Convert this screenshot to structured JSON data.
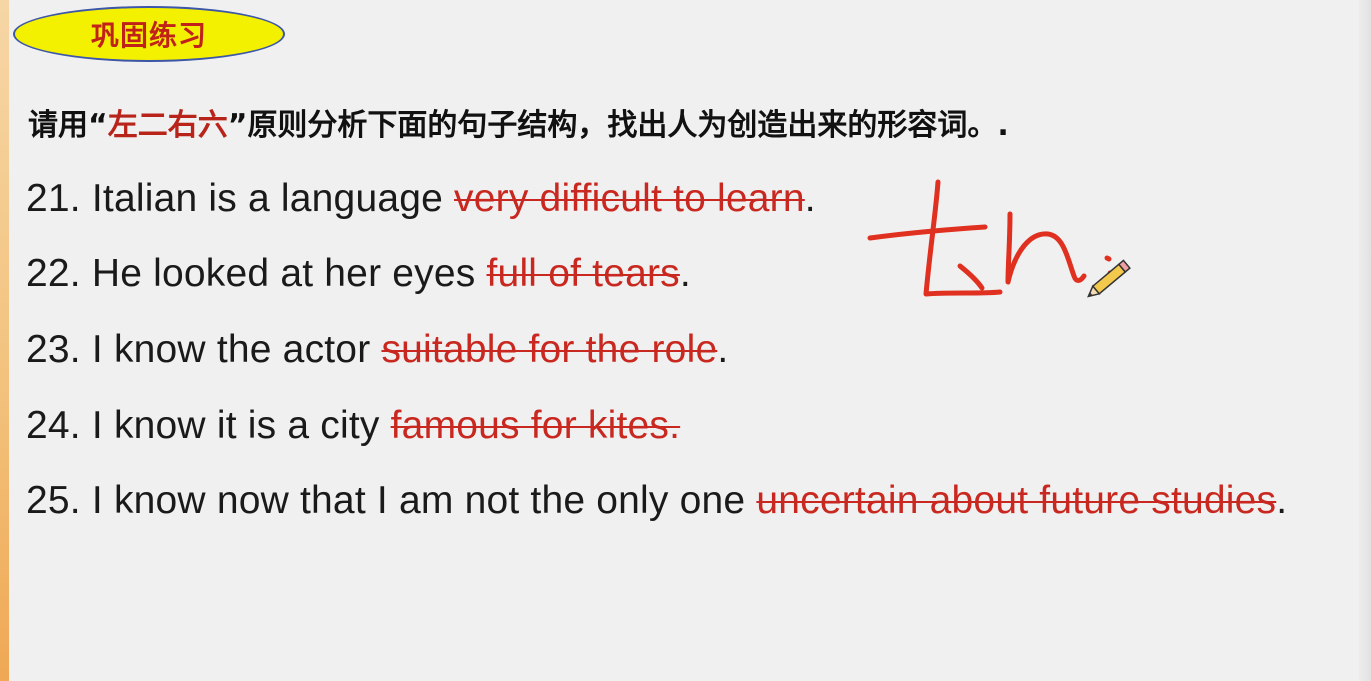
{
  "title": "巩固练习",
  "instruction": {
    "prefix": "请用",
    "open_quote": "“",
    "highlight": "左二右六",
    "close_quote": "”",
    "suffix": "原则分析下面的句子结构，找出人为创造出来的形容词。."
  },
  "sentences": [
    {
      "number": "21.",
      "text": "Italian is a language",
      "struck": "very difficult to learn",
      "end": "."
    },
    {
      "number": "22.",
      "text": "He looked at her eyes",
      "struck": "full of tears",
      "end": "."
    },
    {
      "number": "23.",
      "text": "I know the actor",
      "struck": "suitable for the role",
      "end": "."
    },
    {
      "number": "24.",
      "text": "I know it is a city",
      "struck": "famous for kites.",
      "end": ""
    },
    {
      "number": "25.",
      "text": "I know now that I am not the only one",
      "struck": "uncertain about future studies",
      "end": "."
    }
  ],
  "colors": {
    "title_text": "#c0221a",
    "badge_fill": "#f3f000",
    "badge_border": "#3d57a8",
    "highlight_text": "#b8231a",
    "strike_text": "#c8281f",
    "ink": "#e0301f"
  },
  "icons": {
    "pen_cursor": "pencil-icon"
  }
}
